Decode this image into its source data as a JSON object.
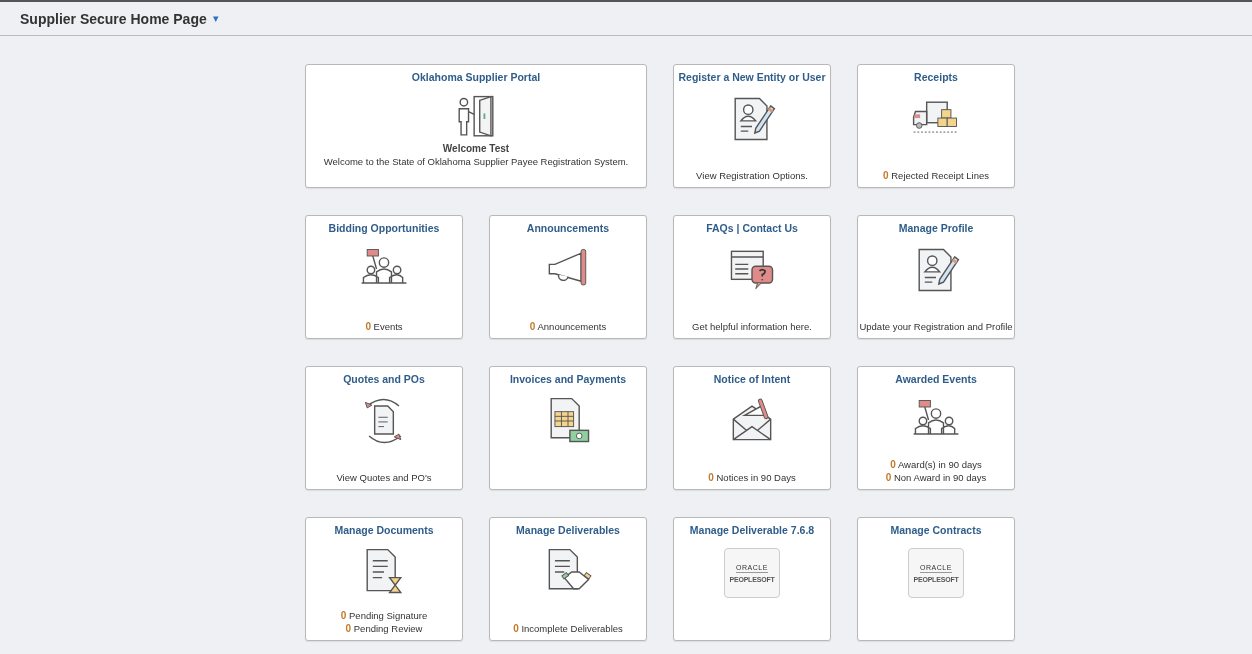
{
  "header": {
    "title": "Supplier Secure Home Page",
    "menu_caret": "▾"
  },
  "tiles": [
    {
      "title": "Oklahoma Supplier Portal",
      "kind": "door",
      "wide": true,
      "subtitle": "Welcome Test",
      "lines": [
        {
          "text": "Welcome to the State of Oklahoma Supplier Payee Registration System."
        }
      ]
    },
    {
      "title": "Register a New Entity or User",
      "kind": "profile",
      "lines": [
        {
          "text": "View Registration Options."
        }
      ]
    },
    {
      "title": "Receipts",
      "kind": "truck",
      "lines": [
        {
          "count": "0",
          "text": "Rejected Receipt Lines"
        }
      ]
    },
    {
      "title": "Bidding Opportunities",
      "kind": "bidding",
      "lines": [
        {
          "count": "0",
          "text": "Events"
        }
      ]
    },
    {
      "title": "Announcements",
      "kind": "megaphone",
      "lines": [
        {
          "count": "0",
          "text": "Announcements"
        }
      ]
    },
    {
      "title": "FAQs | Contact Us",
      "kind": "faq",
      "lines": [
        {
          "text": "Get helpful information here."
        }
      ]
    },
    {
      "title": "Manage Profile",
      "kind": "profile",
      "lines": [
        {
          "text": "Update your Registration and Profile"
        }
      ]
    },
    {
      "title": "Quotes and POs",
      "kind": "cycle",
      "lines": [
        {
          "text": "View Quotes and PO's"
        }
      ]
    },
    {
      "title": "Invoices and Payments",
      "kind": "invoice"
    },
    {
      "title": "Notice of Intent",
      "kind": "envelope",
      "lines": [
        {
          "count": "0",
          "text": "Notices in 90 Days"
        }
      ]
    },
    {
      "title": "Awarded Events",
      "kind": "bidding",
      "lines": [
        {
          "count": "0",
          "text": "Award(s) in 90 days"
        },
        {
          "count": "0",
          "text": "Non Award in 90 days"
        }
      ]
    },
    {
      "title": "Manage Documents",
      "kind": "hourglass",
      "lines": [
        {
          "count": "0",
          "text": "Pending Signature"
        },
        {
          "count": "0",
          "text": "Pending Review"
        }
      ]
    },
    {
      "title": "Manage Deliverables",
      "kind": "handshake",
      "lines": [
        {
          "count": "0",
          "text": "Incomplete Deliverables"
        }
      ]
    },
    {
      "title": "Manage Deliverable 7.6.8",
      "kind": "oracle",
      "logo": [
        "ORACLE",
        "PEOPLESOFT"
      ]
    },
    {
      "title": "Manage Contracts",
      "kind": "oracle",
      "logo": [
        "ORACLE",
        "PEOPLESOFT"
      ]
    }
  ]
}
